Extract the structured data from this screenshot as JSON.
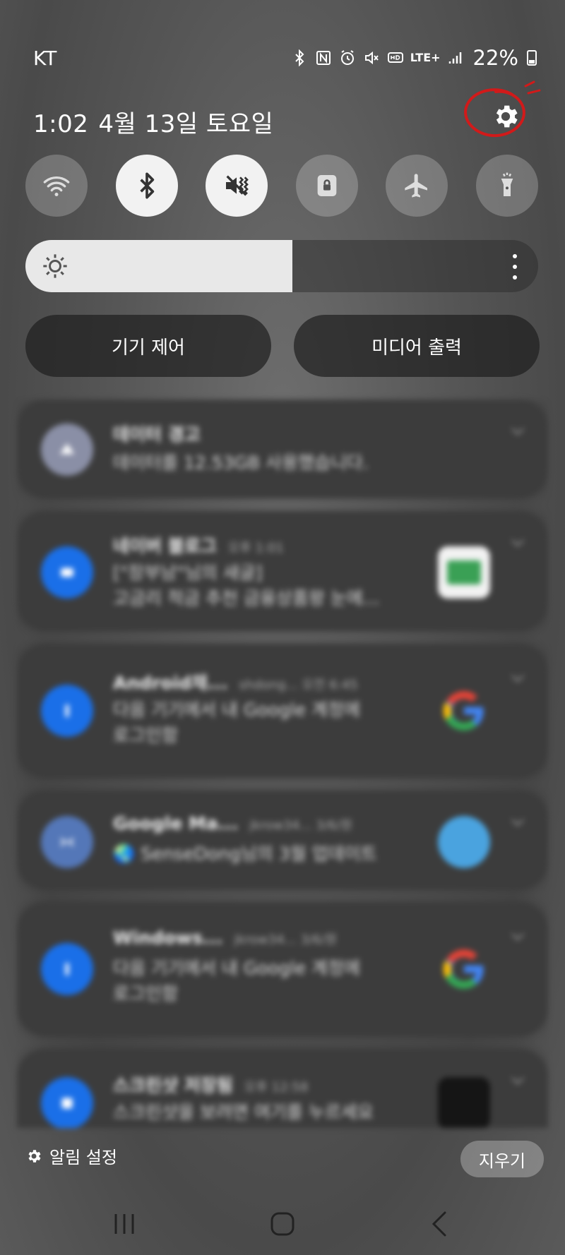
{
  "status_bar": {
    "carrier": "KT",
    "network": "LTE+",
    "battery": "22%",
    "icons": [
      "bluetooth-icon",
      "nfc-icon",
      "alarm-icon",
      "mute-icon",
      "hd-icon",
      "lte-icon",
      "signal-icon",
      "battery-icon"
    ]
  },
  "header": {
    "time": "1:02",
    "date": "4월 13일 토요일"
  },
  "quick_settings": [
    {
      "name": "wifi",
      "icon": "wifi-icon",
      "state": "off"
    },
    {
      "name": "bluetooth",
      "icon": "bluetooth-icon",
      "state": "on"
    },
    {
      "name": "sound",
      "icon": "mute-icon",
      "state": "on"
    },
    {
      "name": "rotation-lock",
      "icon": "lock-icon",
      "state": "off"
    },
    {
      "name": "airplane-mode",
      "icon": "airplane-icon",
      "state": "off"
    },
    {
      "name": "flashlight",
      "icon": "flashlight-icon",
      "state": "off"
    }
  ],
  "brightness": {
    "level": 0.52
  },
  "controls": {
    "device_control": "기기 제어",
    "media_output": "미디어 출력"
  },
  "notifications": [
    {
      "title": "데이터 경고",
      "meta": "",
      "body": [
        "데이터를 12.53GB 사용했습니다."
      ],
      "icon_color": "#8a8fa6",
      "thumb": ""
    },
    {
      "title": "네이버 블로그",
      "meta": "오후 1:01",
      "body": [
        "[\"장부남\"님의 새글]",
        "고금리 적금 추천 금융상품왕 눈에..."
      ],
      "icon_color": "#1a6fe8",
      "thumb": "#3aa055"
    },
    {
      "title": "Android채...",
      "meta": "shdong... 오전 6:45",
      "body": [
        "다음 기기에서 내 Google 계정에",
        "로그인함"
      ],
      "icon_color": "#1a6fe8",
      "thumb": "google"
    },
    {
      "title": "Google Ma...",
      "meta": "jkrow34... 3/6/원",
      "body": [
        "🌏 SenseDong님의 3월 업데이트"
      ],
      "icon_color": "#5477b8",
      "thumb": "#4aa3df"
    },
    {
      "title": "Windows...",
      "meta": "jkrow34... 3/6/원",
      "body": [
        "다음 기기에서 내 Google 계정에",
        "로그인함"
      ],
      "icon_color": "#1a6fe8",
      "thumb": "google"
    },
    {
      "title": "스크린샷 저장됨",
      "meta": "오후 12:58",
      "body": [
        "스크린샷을 보려면 여기를 누르세요"
      ],
      "icon_color": "#1a6fe8",
      "thumb": "#151515"
    }
  ],
  "footer": {
    "notification_settings": "알림 설정",
    "clear": "지우기"
  },
  "navbar": {
    "recents": "recents-icon",
    "home": "home-icon",
    "back": "back-icon"
  },
  "colors": {
    "annotation_red": "#d11a1a",
    "google_blue": "#4285F4",
    "google_red": "#EA4335",
    "google_yellow": "#FBBC05",
    "google_green": "#34A853"
  }
}
